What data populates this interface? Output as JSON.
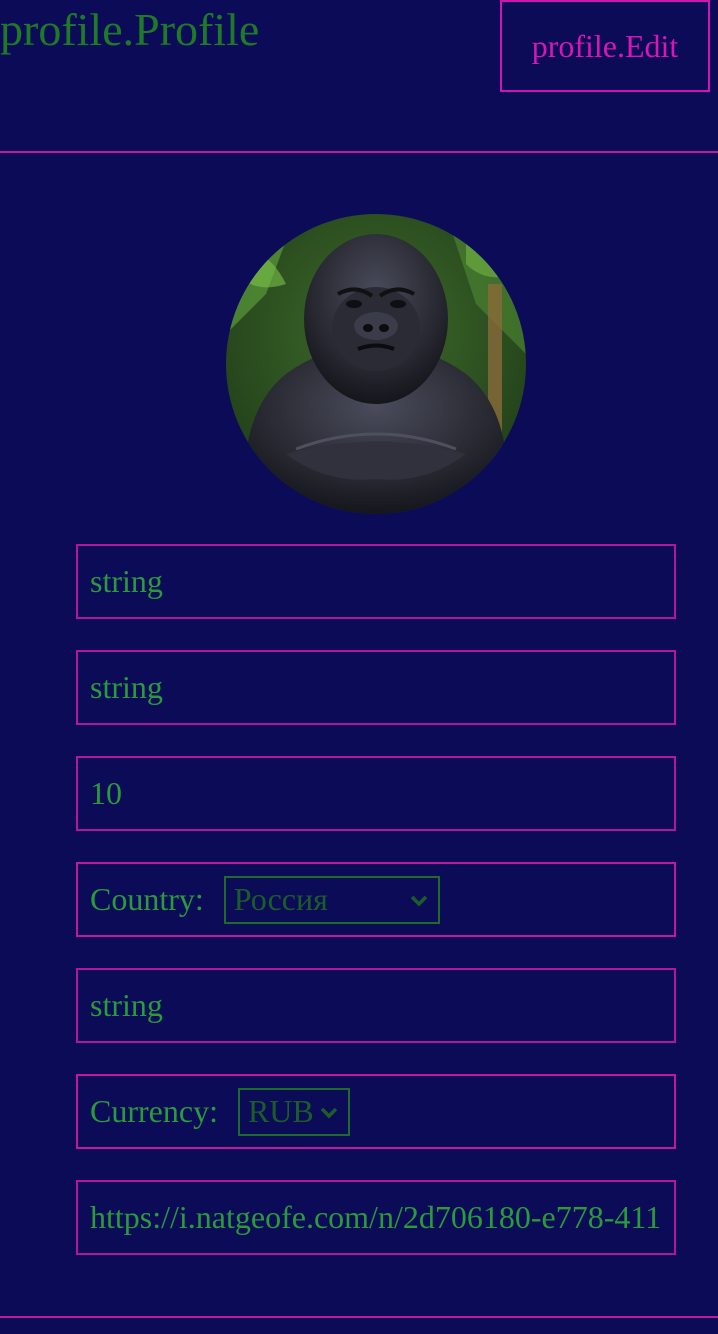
{
  "header": {
    "title": "profile.Profile",
    "edit_label": "profile.Edit"
  },
  "avatar": {
    "icon": "gorilla-avatar-photo"
  },
  "form": {
    "first_name": "string",
    "last_name": "string",
    "age": "10",
    "country": {
      "label": "Country:",
      "selected": "Россия"
    },
    "city": "string",
    "currency": {
      "label": "Currency:",
      "selected": "RUB"
    },
    "avatar_url": "https://i.natgeofe.com/n/2d706180-e778-411"
  },
  "colors": {
    "background": "#0b0b57",
    "accent": "#d014b4",
    "text": "#2a9a3a"
  }
}
